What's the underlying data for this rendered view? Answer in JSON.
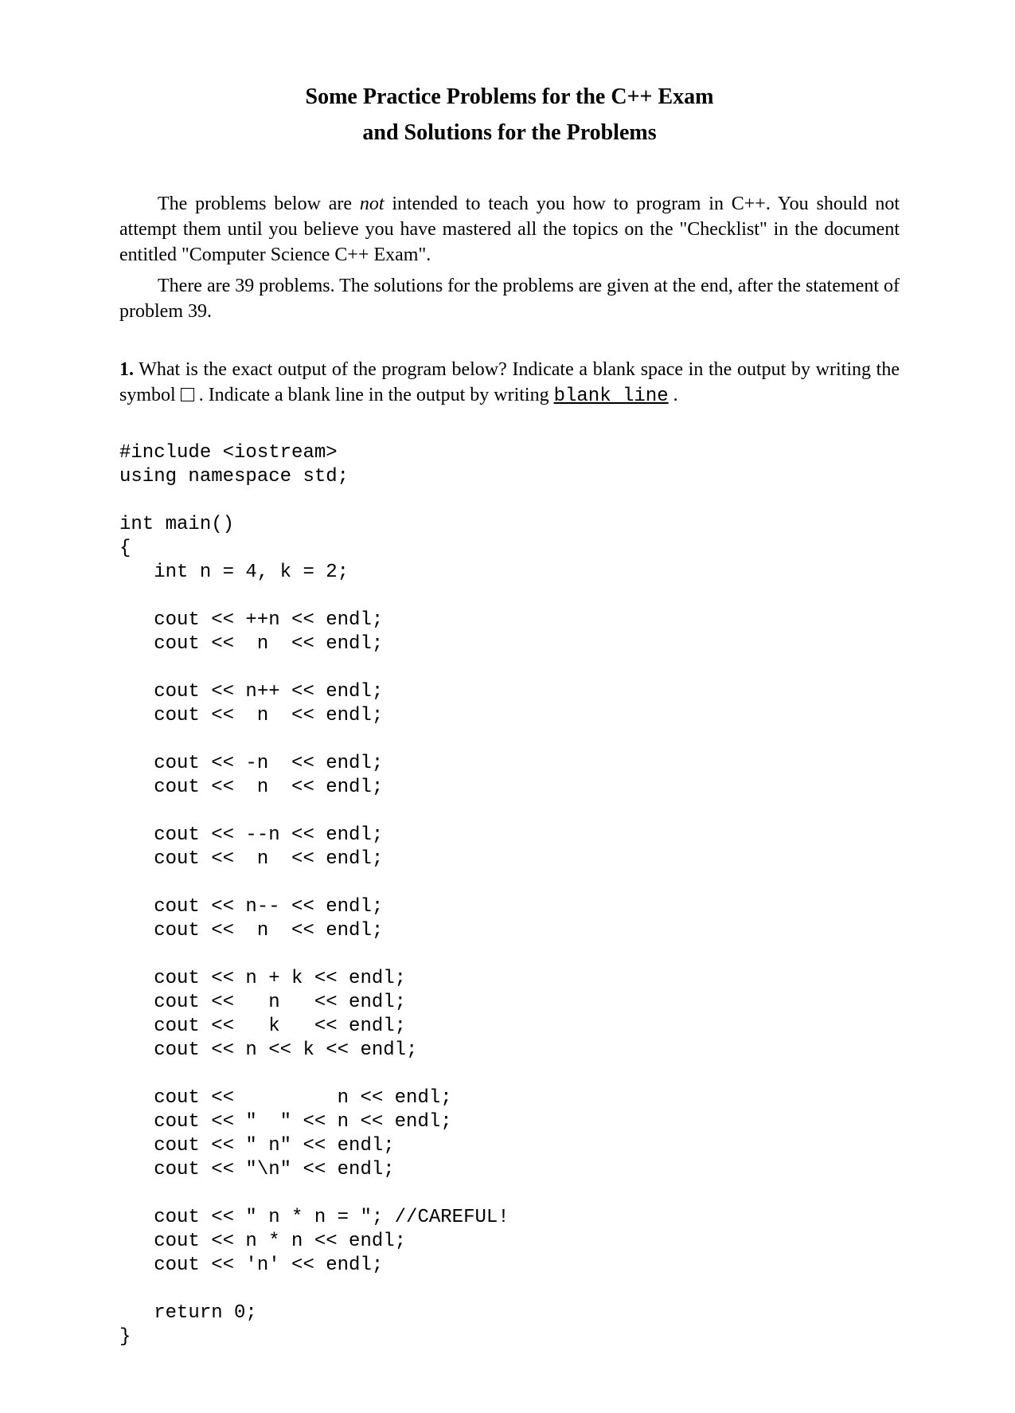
{
  "title_line1": "Some Practice Problems for the C++ Exam",
  "title_line2": "and Solutions for the Problems",
  "intro": {
    "p1a": "The problems below are ",
    "p1_not": "not",
    "p1b": " intended to teach you how to program in C++.  You should not attempt them until you believe you have mastered all the topics on the \"Checklist\" in the document entitled \"Computer Science C++ Exam\".",
    "p2": "There are 39 problems.  The solutions for the problems are given at the end, after the statement of problem 39."
  },
  "q1": {
    "num": "1.",
    "text_a": "  What is the exact output of the program below?  Indicate a blank space in the output by writing the symbol  ",
    "text_b": " .  Indicate a blank line in the output by writing  ",
    "blank_line": "blank line",
    "text_c": " ."
  },
  "code": "#include <iostream>\nusing namespace std;\n\nint main()\n{\n   int n = 4, k = 2;\n\n   cout << ++n << endl;\n   cout <<  n  << endl;\n\n   cout << n++ << endl;\n   cout <<  n  << endl;\n\n   cout << -n  << endl;\n   cout <<  n  << endl;\n\n   cout << --n << endl;\n   cout <<  n  << endl;\n\n   cout << n-- << endl;\n   cout <<  n  << endl;\n\n   cout << n + k << endl;\n   cout <<   n   << endl;\n   cout <<   k   << endl;\n   cout << n << k << endl;\n\n   cout <<         n << endl;\n   cout << \"  \" << n << endl;\n   cout << \" n\" << endl;\n   cout << \"\\n\" << endl;\n\n   cout << \" n * n = \"; //CAREFUL!\n   cout << n * n << endl;\n   cout << 'n' << endl;\n\n   return 0;\n}"
}
